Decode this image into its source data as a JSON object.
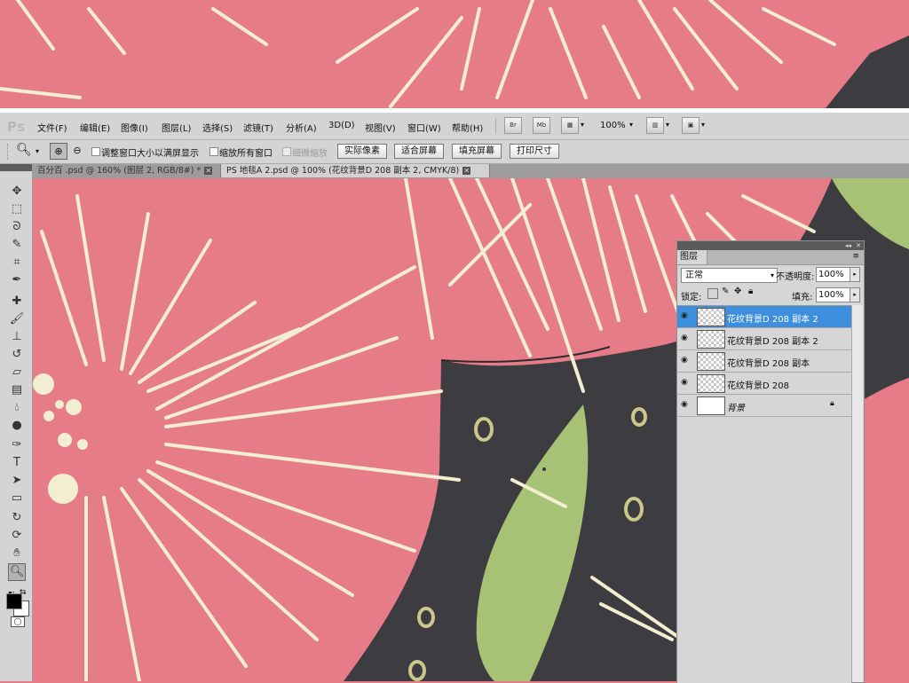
{
  "app": {
    "logo": "Ps"
  },
  "menubar": {
    "items": [
      "文件(F)",
      "编辑(E)",
      "图像(I)",
      "图层(L)",
      "选择(S)",
      "滤镜(T)",
      "分析(A)",
      "3D(D)",
      "视图(V)",
      "窗口(W)",
      "帮助(H)"
    ],
    "bridge_label": "Br",
    "minibridge_label": "Mb",
    "zoom_value": "100%"
  },
  "options": {
    "resize_windows_label": "调整窗口大小以满屏显示",
    "zoom_all_label": "缩放所有窗口",
    "scrubby_label": "细微缩放",
    "actual_pixels": "实际像素",
    "fit_screen": "适合屏幕",
    "fill_screen": "填充屏幕",
    "print_size": "打印尺寸"
  },
  "tabs": [
    {
      "label": "百分百 .psd @ 160% (图层 2, RGB/8#) *",
      "active": false
    },
    {
      "label": "PS 地毯A 2.psd @ 100% (花纹背景D 208 副本 2, CMYK/8)",
      "active": true
    }
  ],
  "tools": [
    "move-tool-icon",
    "marquee-tool-icon",
    "lasso-tool-icon",
    "quick-select-icon",
    "crop-tool-icon",
    "eyedropper-icon",
    "healing-brush-icon",
    "brush-tool-icon",
    "clone-stamp-icon",
    "history-brush-icon",
    "eraser-icon",
    "gradient-icon",
    "blur-icon",
    "dodge-icon",
    "pen-tool-icon",
    "type-tool-icon",
    "path-select-icon",
    "shape-tool-icon",
    "3d-rotate-icon",
    "3d-orbit-icon",
    "hand-tool-icon",
    "zoom-tool-icon"
  ],
  "layers_panel": {
    "title": "图层",
    "blend_mode": "正常",
    "opacity_label": "不透明度:",
    "opacity_value": "100%",
    "lock_label": "锁定:",
    "fill_label": "填充:",
    "fill_value": "100%",
    "layers": [
      {
        "name": "花纹背景D 208 副本 2",
        "selected": true
      },
      {
        "name": "花纹背景D 208 副本 2",
        "selected": false
      },
      {
        "name": "花纹背景D 208 副本",
        "selected": false
      },
      {
        "name": "花纹背景D 208",
        "selected": false
      },
      {
        "name": "背景",
        "selected": false
      }
    ]
  },
  "colors": {
    "pink": "#e77c89",
    "cream": "#f2eed2",
    "dark": "#3d3c40",
    "green": "#a7c274",
    "selection": "#3e8ede"
  }
}
